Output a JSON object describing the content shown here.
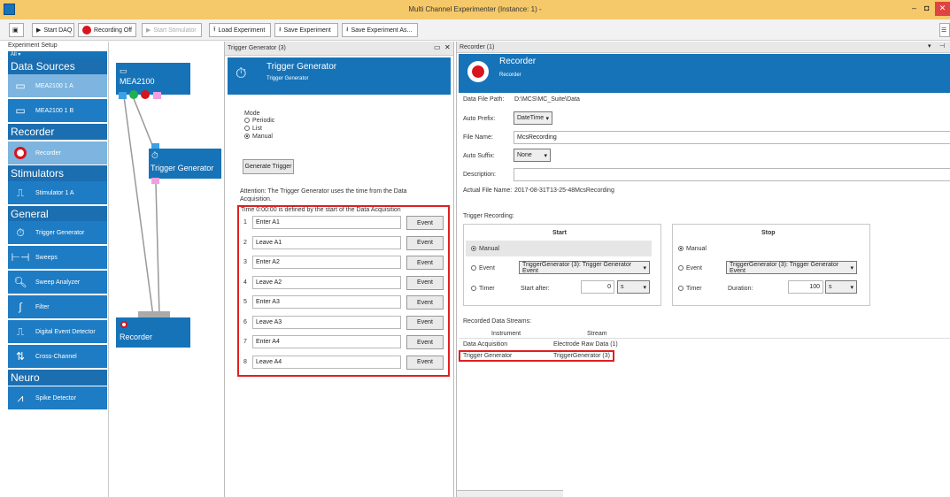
{
  "window": {
    "title": "Multi Channel Experimenter (Instance: 1) -",
    "min": "–",
    "max": "◘",
    "close": "✕"
  },
  "toolbar": {
    "start_daq": "Start DAQ",
    "recording_off": "Recording Off",
    "start_stimulator": "Start Stimulator",
    "load_experiment": "Load Experiment",
    "save_experiment": "Save Experiment",
    "save_experiment_as": "Save Experiment As..."
  },
  "sidebar": {
    "panel_title": "Experiment Setup",
    "filter": "All",
    "sections": {
      "data_sources": "Data Sources",
      "recorder": "Recorder",
      "stimulators": "Stimulators",
      "general": "General",
      "neuro": "Neuro"
    },
    "items": {
      "mea_a": "MEA2100  1  A",
      "mea_b": "MEA2100  1  B",
      "recorder": "Recorder",
      "stimulator": "Stimulator  1  A",
      "trigger_generator": "Trigger Generator",
      "sweeps": "Sweeps",
      "sweep_analyzer": "Sweep Analyzer",
      "filter": "Filter",
      "digital_event_detector": "Digital Event Detector",
      "cross_channel": "Cross-Channel",
      "spike_detector": "Spike Detector"
    }
  },
  "canvas": {
    "mea_node": "MEA2100",
    "trigger_node": "Trigger Generator",
    "recorder_node": "Recorder"
  },
  "trigger_panel": {
    "tab_title": "Trigger Generator (3)",
    "header_title": "Trigger Generator",
    "header_subtitle": "Trigger Generator",
    "mode_label": "Mode",
    "modes": [
      "Periodic",
      "List",
      "Manual"
    ],
    "generate_button": "Generate Trigger",
    "attention": "Attention: The Trigger Generator uses the time from the Data Acquisition.",
    "time_note": "Time 0:00:00 is defined by the start of the Data Acquisition",
    "rows": [
      {
        "num": "1",
        "value": "Enter A1",
        "button": "Event"
      },
      {
        "num": "2",
        "value": "Leave A1",
        "button": "Event"
      },
      {
        "num": "3",
        "value": "Enter A2",
        "button": "Event"
      },
      {
        "num": "4",
        "value": "Leave A2",
        "button": "Event"
      },
      {
        "num": "5",
        "value": "Enter A3",
        "button": "Event"
      },
      {
        "num": "6",
        "value": "Leave A3",
        "button": "Event"
      },
      {
        "num": "7",
        "value": "Enter A4",
        "button": "Event"
      },
      {
        "num": "8",
        "value": "Leave A4",
        "button": "Event"
      }
    ]
  },
  "recorder_panel": {
    "tab_title": "Recorder (1)",
    "header_title": "Recorder",
    "header_subtitle": "Recorder",
    "data_file_path_label": "Data File Path:",
    "data_file_path": "D:\\MCS\\MC_Suite\\Data",
    "auto_prefix_label": "Auto Prefix:",
    "auto_prefix": "DateTime",
    "file_name_label": "File Name:",
    "file_name": "McsRecording",
    "auto_suffix_label": "Auto Suffix:",
    "auto_suffix": "None",
    "description_label": "Description:",
    "actual_file_name_label": "Actual File Name:",
    "actual_file_name": "2017-08-31T13-25-48McsRecording",
    "trigger_recording_label": "Trigger Recording:",
    "start": {
      "title": "Start",
      "manual": "Manual",
      "event": "Event",
      "event_value": "TriggerGenerator (3): Trigger Generator Event",
      "timer": "Timer",
      "start_after_label": "Start after:",
      "start_after_value": "0",
      "unit": "s"
    },
    "stop": {
      "title": "Stop",
      "manual": "Manual",
      "event": "Event",
      "event_value": "TriggerGenerator (3): Trigger Generator Event",
      "timer": "Timer",
      "duration_label": "Duration:",
      "duration_value": "100",
      "unit": "s"
    },
    "streams_label": "Recorded Data Streams:",
    "streams_headers": [
      "Instrument",
      "Stream"
    ],
    "streams": [
      {
        "instrument": "Data Acquisition",
        "stream": "Electrode Raw Data (1)"
      },
      {
        "instrument": "Trigger Generator",
        "stream": "TriggerGenerator (3)"
      }
    ]
  },
  "colors": {
    "accent": "#1673b8",
    "highlight": "#e02020",
    "titlebar": "#f5c86a"
  }
}
